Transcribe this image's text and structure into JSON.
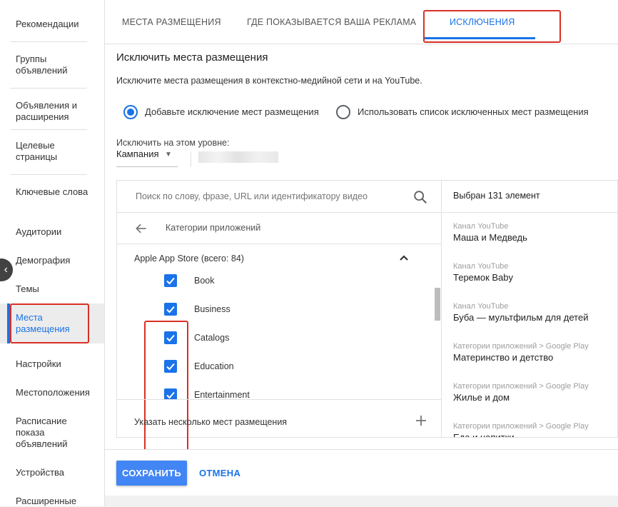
{
  "sidebar": {
    "items": [
      {
        "label": "Рекомендации"
      },
      {
        "label": "Группы объявлений"
      },
      {
        "label": "Объявления и расширения"
      },
      {
        "label": "Целевые страницы"
      },
      {
        "label": "Ключевые слова"
      },
      {
        "label": "Аудитории"
      },
      {
        "label": "Демография"
      },
      {
        "label": "Темы"
      },
      {
        "label": "Места размещения",
        "active": true
      },
      {
        "label": "Настройки"
      },
      {
        "label": "Местоположения"
      },
      {
        "label": "Расписание показа объявлений"
      },
      {
        "label": "Устройства"
      },
      {
        "label": "Расширенные"
      }
    ]
  },
  "tabs": [
    {
      "label": "МЕСТА РАЗМЕЩЕНИЯ"
    },
    {
      "label": "ГДЕ ПОКАЗЫВАЕТСЯ ВАША РЕКЛАМА"
    },
    {
      "label": "ИСКЛЮЧЕНИЯ",
      "active": true
    }
  ],
  "section": {
    "title": "Исключить места размещения",
    "description": "Исключите места размещения в контекстно-медийной сети и на YouTube."
  },
  "radios": [
    {
      "label": "Добавьте исключение мест размещения",
      "checked": true
    },
    {
      "label": "Использовать список исключенных мест размещения",
      "checked": false
    }
  ],
  "level": {
    "label": "Исключить на этом уровне:",
    "value": "Кампания"
  },
  "search": {
    "placeholder": "Поиск по слову, фразе, URL или идентификатору видео"
  },
  "breadcrumb": "Категории приложений",
  "group": {
    "header": "Apple App Store (всего: 84)",
    "items": [
      {
        "label": "Book",
        "checked": true
      },
      {
        "label": "Business",
        "checked": true
      },
      {
        "label": "Catalogs",
        "checked": true
      },
      {
        "label": "Education",
        "checked": true
      },
      {
        "label": "Entertainment",
        "checked": true
      }
    ]
  },
  "multi_add": {
    "label": "Указать несколько мест размещения"
  },
  "selected": {
    "count_label": "Выбран 131 элемент",
    "items": [
      {
        "type": "Канал YouTube",
        "name": "Маша и Медведь"
      },
      {
        "type": "Канал YouTube",
        "name": "Теремок Baby"
      },
      {
        "type": "Канал YouTube",
        "name": "Буба — мультфильм для детей"
      },
      {
        "type": "Категории приложений > Google Play",
        "name": "Материнство и детство"
      },
      {
        "type": "Категории приложений > Google Play",
        "name": "Жилье и дом"
      },
      {
        "type": "Категории приложений > Google Play",
        "name": "Еда и напитки"
      }
    ]
  },
  "footer": {
    "save_label": "СОХРАНИТЬ",
    "cancel_label": "ОТМЕНА"
  },
  "colors": {
    "accent": "#1a73e8",
    "primary_button": "#4285f4",
    "highlight": "#d93025"
  }
}
